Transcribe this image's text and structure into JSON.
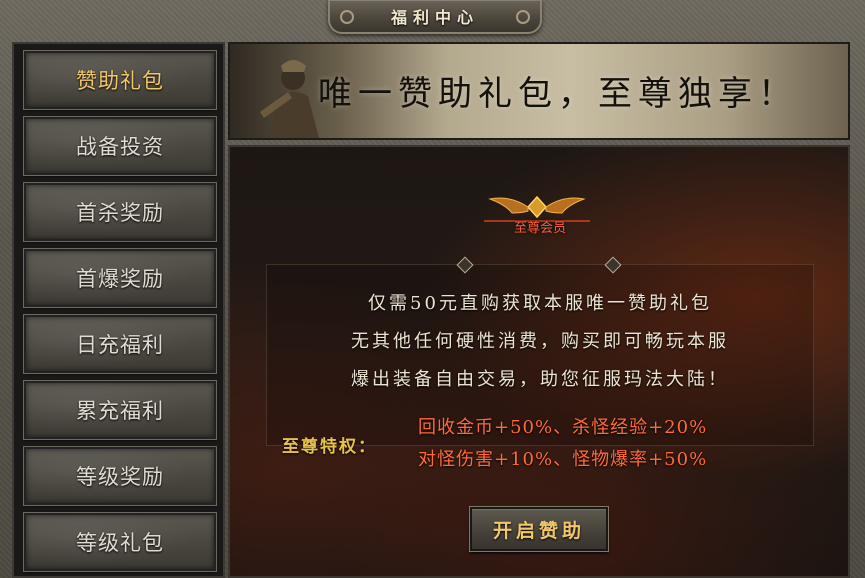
{
  "window": {
    "title": "福利中心"
  },
  "sidebar": {
    "items": [
      {
        "label": "赞助礼包",
        "active": true
      },
      {
        "label": "战备投资",
        "active": false
      },
      {
        "label": "首杀奖励",
        "active": false
      },
      {
        "label": "首爆奖励",
        "active": false
      },
      {
        "label": "日充福利",
        "active": false
      },
      {
        "label": "累充福利",
        "active": false
      },
      {
        "label": "等级奖励",
        "active": false
      },
      {
        "label": "等级礼包",
        "active": false
      }
    ]
  },
  "banner": {
    "slogan": "唯一赞助礼包，至尊独享！"
  },
  "badge": {
    "label": "至尊会员"
  },
  "description": {
    "lines": [
      "仅需50元直购获取本服唯一赞助礼包",
      "无其他任何硬性消费，购买即可畅玩本服",
      "爆出装备自由交易，助您征服玛法大陆！"
    ]
  },
  "privileges": {
    "label": "至尊特权：",
    "lines": [
      "回收金币+50%、杀怪经验+20%",
      "对怪伤害+10%、怪物爆率+50%"
    ]
  },
  "actions": {
    "start_label": "开启赞助"
  },
  "colors": {
    "active_tab": "#f2c96a",
    "privilege_label": "#e6c24a",
    "privilege_value": "#ff6a3c",
    "badge_text": "#ff5a3a"
  }
}
